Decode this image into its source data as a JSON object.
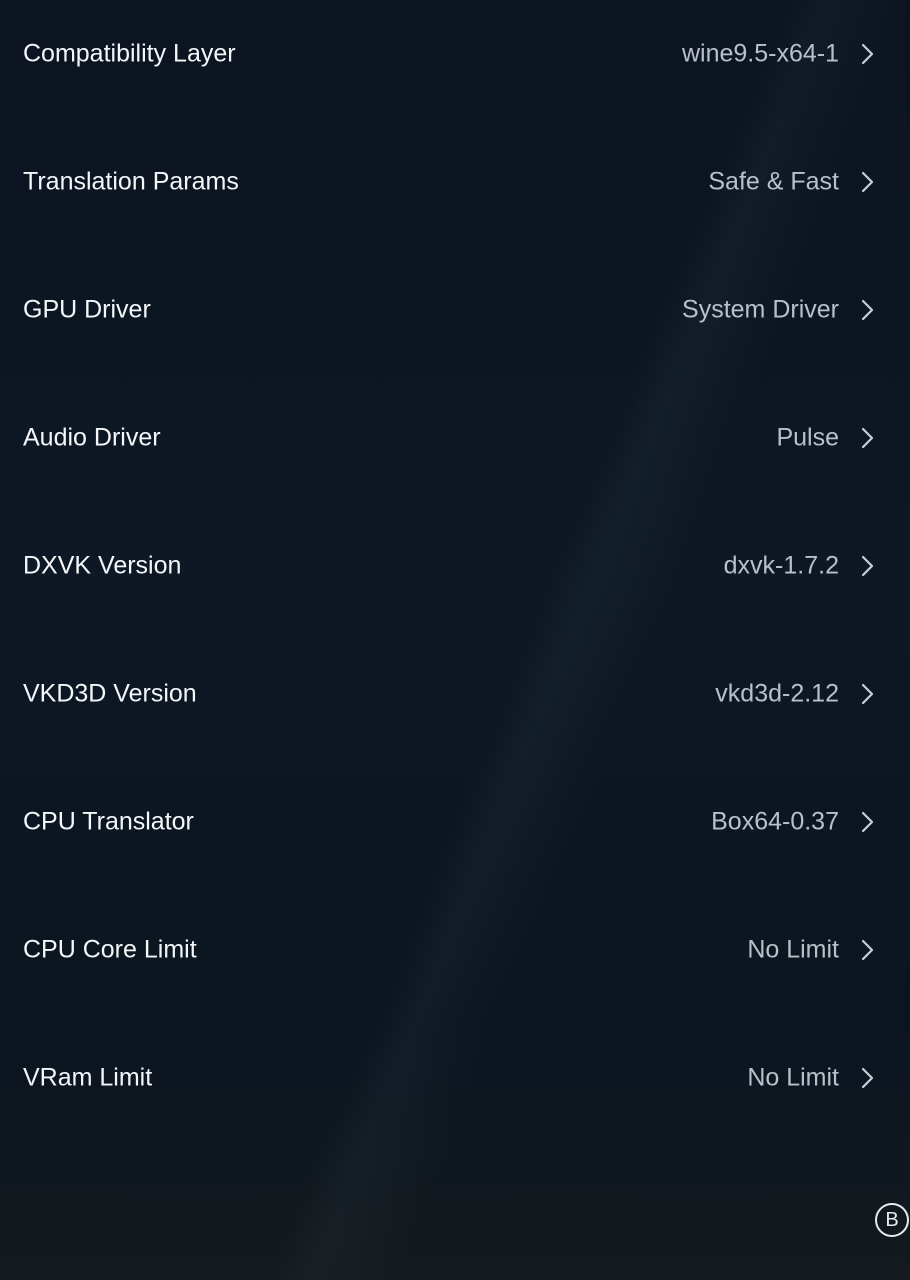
{
  "settings": [
    {
      "label": "Compatibility Layer",
      "value": "wine9.5-x64-1"
    },
    {
      "label": "Translation Params",
      "value": "Safe & Fast"
    },
    {
      "label": "GPU Driver",
      "value": "System Driver"
    },
    {
      "label": "Audio Driver",
      "value": "Pulse"
    },
    {
      "label": "DXVK Version",
      "value": "dxvk-1.7.2"
    },
    {
      "label": "VKD3D Version",
      "value": "vkd3d-2.12"
    },
    {
      "label": "CPU Translator",
      "value": "Box64-0.37"
    },
    {
      "label": "CPU Core Limit",
      "value": "No Limit"
    },
    {
      "label": "VRam Limit",
      "value": "No Limit"
    }
  ],
  "overlay": {
    "b_button_label": "B"
  },
  "icons": {
    "row_chevron": "chevron-right-icon"
  },
  "colors": {
    "background": "#0c1521",
    "label": "#f4f6f8",
    "value": "#b9c0c8",
    "chevron": "#c9cfd6"
  }
}
